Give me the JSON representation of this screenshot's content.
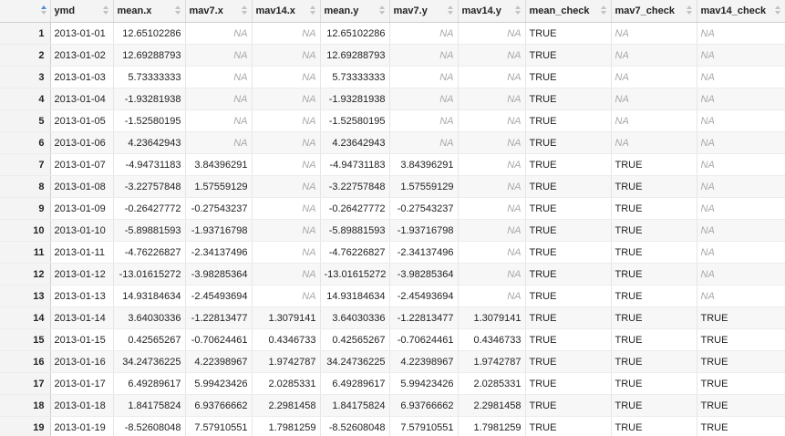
{
  "columns": [
    "",
    "ymd",
    "mean.x",
    "mav7.x",
    "mav14.x",
    "mean.y",
    "mav7.y",
    "mav14.y",
    "mean_check",
    "mav7_check",
    "mav14_check"
  ],
  "column_align": [
    "right",
    "left",
    "right",
    "right",
    "right",
    "right",
    "right",
    "right",
    "left",
    "left",
    "left"
  ],
  "na_label": "NA",
  "accent_color": "#4a8fd9",
  "rows": [
    [
      "1",
      "2013-01-01",
      "12.65102286",
      "NA",
      "NA",
      "12.65102286",
      "NA",
      "NA",
      "TRUE",
      "NA",
      "NA"
    ],
    [
      "2",
      "2013-01-02",
      "12.69288793",
      "NA",
      "NA",
      "12.69288793",
      "NA",
      "NA",
      "TRUE",
      "NA",
      "NA"
    ],
    [
      "3",
      "2013-01-03",
      "5.73333333",
      "NA",
      "NA",
      "5.73333333",
      "NA",
      "NA",
      "TRUE",
      "NA",
      "NA"
    ],
    [
      "4",
      "2013-01-04",
      "-1.93281938",
      "NA",
      "NA",
      "-1.93281938",
      "NA",
      "NA",
      "TRUE",
      "NA",
      "NA"
    ],
    [
      "5",
      "2013-01-05",
      "-1.52580195",
      "NA",
      "NA",
      "-1.52580195",
      "NA",
      "NA",
      "TRUE",
      "NA",
      "NA"
    ],
    [
      "6",
      "2013-01-06",
      "4.23642943",
      "NA",
      "NA",
      "4.23642943",
      "NA",
      "NA",
      "TRUE",
      "NA",
      "NA"
    ],
    [
      "7",
      "2013-01-07",
      "-4.94731183",
      "3.84396291",
      "NA",
      "-4.94731183",
      "3.84396291",
      "NA",
      "TRUE",
      "TRUE",
      "NA"
    ],
    [
      "8",
      "2013-01-08",
      "-3.22757848",
      "1.57559129",
      "NA",
      "-3.22757848",
      "1.57559129",
      "NA",
      "TRUE",
      "TRUE",
      "NA"
    ],
    [
      "9",
      "2013-01-09",
      "-0.26427772",
      "-0.27543237",
      "NA",
      "-0.26427772",
      "-0.27543237",
      "NA",
      "TRUE",
      "TRUE",
      "NA"
    ],
    [
      "10",
      "2013-01-10",
      "-5.89881593",
      "-1.93716798",
      "NA",
      "-5.89881593",
      "-1.93716798",
      "NA",
      "TRUE",
      "TRUE",
      "NA"
    ],
    [
      "11",
      "2013-01-11",
      "-4.76226827",
      "-2.34137496",
      "NA",
      "-4.76226827",
      "-2.34137496",
      "NA",
      "TRUE",
      "TRUE",
      "NA"
    ],
    [
      "12",
      "2013-01-12",
      "-13.01615272",
      "-3.98285364",
      "NA",
      "-13.01615272",
      "-3.98285364",
      "NA",
      "TRUE",
      "TRUE",
      "NA"
    ],
    [
      "13",
      "2013-01-13",
      "14.93184634",
      "-2.45493694",
      "NA",
      "14.93184634",
      "-2.45493694",
      "NA",
      "TRUE",
      "TRUE",
      "NA"
    ],
    [
      "14",
      "2013-01-14",
      "3.64030336",
      "-1.22813477",
      "1.3079141",
      "3.64030336",
      "-1.22813477",
      "1.3079141",
      "TRUE",
      "TRUE",
      "TRUE"
    ],
    [
      "15",
      "2013-01-15",
      "0.42565267",
      "-0.70624461",
      "0.4346733",
      "0.42565267",
      "-0.70624461",
      "0.4346733",
      "TRUE",
      "TRUE",
      "TRUE"
    ],
    [
      "16",
      "2013-01-16",
      "34.24736225",
      "4.22398967",
      "1.9742787",
      "34.24736225",
      "4.22398967",
      "1.9742787",
      "TRUE",
      "TRUE",
      "TRUE"
    ],
    [
      "17",
      "2013-01-17",
      "6.49289617",
      "5.99423426",
      "2.0285331",
      "6.49289617",
      "5.99423426",
      "2.0285331",
      "TRUE",
      "TRUE",
      "TRUE"
    ],
    [
      "18",
      "2013-01-18",
      "1.84175824",
      "6.93766662",
      "2.2981458",
      "1.84175824",
      "6.93766662",
      "2.2981458",
      "TRUE",
      "TRUE",
      "TRUE"
    ],
    [
      "19",
      "2013-01-19",
      "-8.52608048",
      "7.57910551",
      "1.7981259",
      "-8.52608048",
      "7.57910551",
      "1.7981259",
      "TRUE",
      "TRUE",
      "TRUE"
    ]
  ]
}
